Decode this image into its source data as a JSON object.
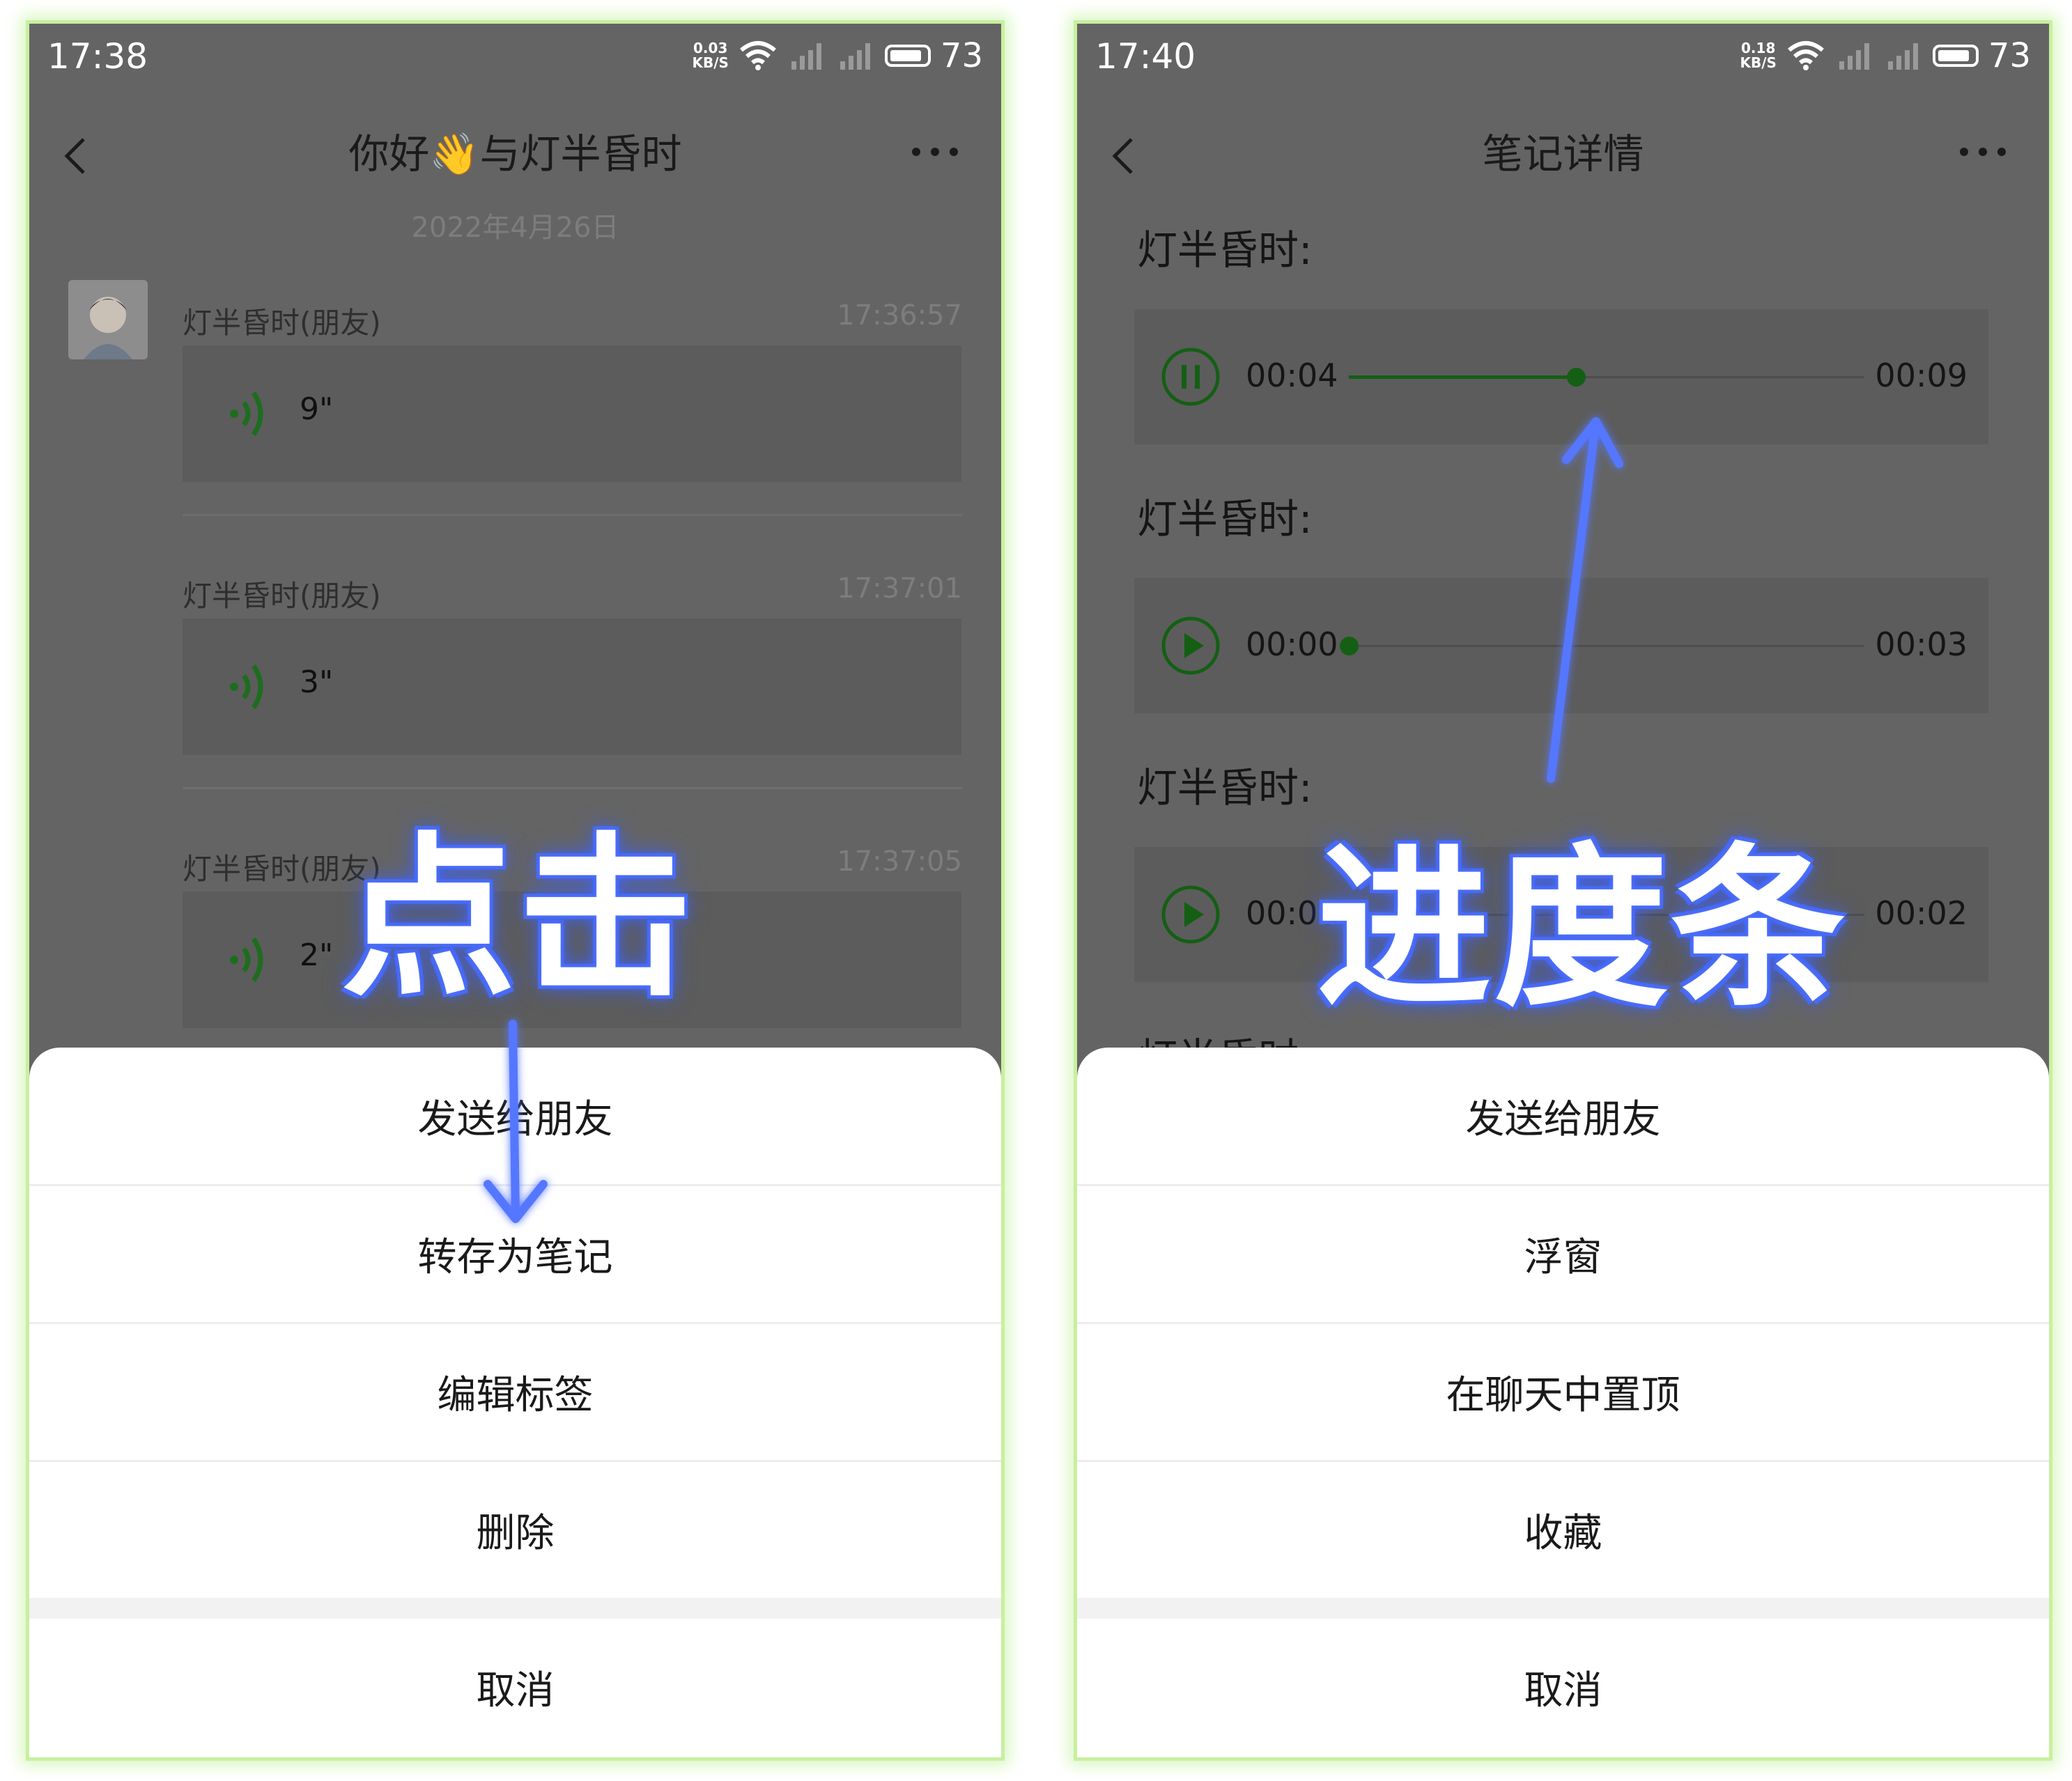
{
  "left_screen": {
    "status": {
      "time": "17:38",
      "net_speed_value": "0.03",
      "net_speed_unit": "KB/S",
      "battery": "73"
    },
    "title": "你好👋与灯半昏时",
    "date": "2022年4月26日",
    "messages": [
      {
        "sender": "灯半昏时(朋友)",
        "time": "17:36:57",
        "duration": "9\""
      },
      {
        "sender": "灯半昏时(朋友)",
        "time": "17:37:01",
        "duration": "3\""
      },
      {
        "sender": "灯半昏时(朋友)",
        "time": "17:37:05",
        "duration": "2\""
      }
    ],
    "sheet": {
      "items": [
        "发送给朋友",
        "转存为笔记",
        "编辑标签",
        "删除"
      ],
      "cancel": "取消"
    },
    "annotation": "点击"
  },
  "right_screen": {
    "status": {
      "time": "17:40",
      "net_speed_value": "0.18",
      "net_speed_unit": "KB/S",
      "battery": "73"
    },
    "title": "笔记详情",
    "notes": [
      {
        "author": "灯半昏时:",
        "current": "00:04",
        "total": "00:09",
        "playing": true,
        "progress": 0.44
      },
      {
        "author": "灯半昏时:",
        "current": "00:00",
        "total": "00:03",
        "playing": false,
        "progress": 0.0
      },
      {
        "author": "灯半昏时:",
        "current": "00:00",
        "total": "00:02",
        "playing": false,
        "progress": 0.0
      }
    ],
    "sheet": {
      "items": [
        "发送给朋友",
        "浮窗",
        "在聊天中置顶",
        "收藏"
      ],
      "cancel": "取消"
    },
    "annotation": "进度条"
  },
  "colors": {
    "accent_green": "#145f14",
    "annotation_blue": "#4c6ef5",
    "frame_green": "#c8f0a0"
  }
}
